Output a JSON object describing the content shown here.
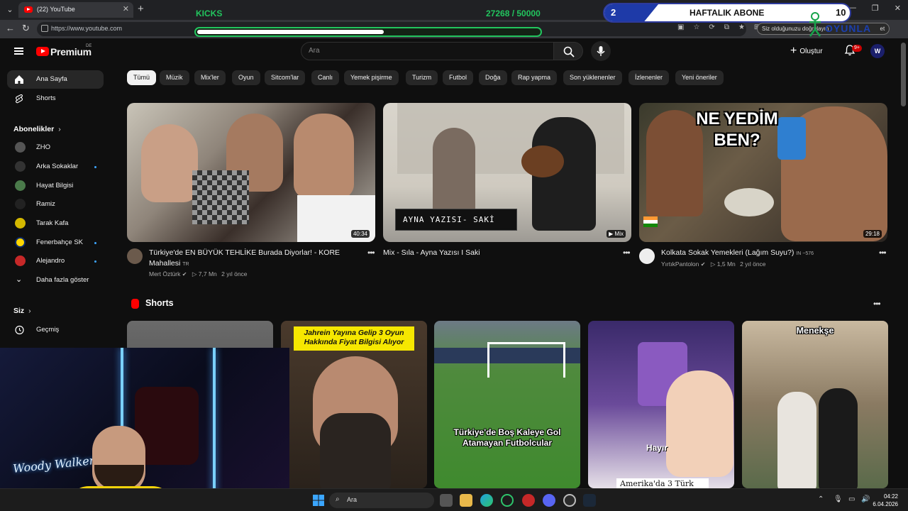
{
  "browser": {
    "tab_title": "(22) YouTube",
    "url": "https://www.youtube.com",
    "incognito_text": "Siz olduğunuzu doğrulayın",
    "incognito_suffix": "et"
  },
  "overlay": {
    "kicks_label": "KICKS",
    "kicks_count": "27268 / 50000",
    "kicks_progress": 0.545,
    "weekly_label": "HAFTALIK ABONE",
    "weekly_current": "2",
    "weekly_goal": "10",
    "brand_text": "OYUNLA"
  },
  "header": {
    "brand": "Premium",
    "region": "DE",
    "search_placeholder": "Ara",
    "create_label": "Oluştur",
    "notif_count": "9+",
    "avatar_letter": "W"
  },
  "sidebar": {
    "main": [
      {
        "label": "Ana Sayfa",
        "icon": "home-icon"
      },
      {
        "label": "Shorts",
        "icon": "shorts-icon"
      }
    ],
    "subs_heading": "Abonelikler",
    "subs": [
      {
        "label": "ZHO",
        "color": "#555",
        "dot": false
      },
      {
        "label": "Arka Sokaklar",
        "color": "#333",
        "dot": true
      },
      {
        "label": "Hayat Bilgisi",
        "color": "#4a7a4a",
        "dot": false
      },
      {
        "label": "Ramiz",
        "color": "#222",
        "dot": false
      },
      {
        "label": "Tarak Kafa",
        "color": "#d4b800",
        "dot": false
      },
      {
        "label": "Fenerbahçe SK",
        "color": "#ffd600",
        "dot": true
      },
      {
        "label": "Alejandro",
        "color": "#c62828",
        "dot": true
      }
    ],
    "show_more": "Daha fazla göster",
    "you_heading": "Siz",
    "history": "Geçmiş"
  },
  "chips": [
    "Tümü",
    "Müzik",
    "Mix'ler",
    "Oyun",
    "Sitcom'lar",
    "Canlı",
    "Yemek pişirme",
    "Turizm",
    "Futbol",
    "Doğa",
    "Rap yapma",
    "Son yüklenenler",
    "İzlenenler",
    "Yeni öneriler"
  ],
  "videos": [
    {
      "title": "Türkiye'de EN BÜYÜK TEHLİKE Burada Diyorlar! - KORE Mahallesi",
      "suffix": "TR",
      "channel": "Mert Öztürk",
      "views": "7,7 Mn",
      "age": "2 yıl önce",
      "duration": "40:34"
    },
    {
      "title": "Mix - Sıla - Ayna Yazısı I Saki",
      "overlay_text": "AYNA YAZISI- SAKİ",
      "badge": "Mix"
    },
    {
      "title": "Kolkata Sokak Yemekleri (Lağım Suyu?)",
      "suffix": "IN ~576",
      "channel": "YırtıkPantolon",
      "views": "1,5 Mn",
      "age": "2 yıl önce",
      "duration": "29:18",
      "overlay_text": "NE YEDİM BEN?"
    }
  ],
  "shorts": {
    "heading": "Shorts",
    "items": [
      {
        "caption": ""
      },
      {
        "caption": "Jahrein Yayına Gelip 3 Oyun Hakkında Fiyat Bilgisi Alıyor"
      },
      {
        "caption": "Türkiye'de Boş Kaleye Gol Atamayan Futbolcular"
      },
      {
        "caption": "Hayır",
        "caption2": "Amerika'da 3 Türk"
      },
      {
        "caption": "Menekşe"
      }
    ]
  },
  "taskbar": {
    "search_label": "Ara",
    "time": "04:22",
    "date": "6.04.2026"
  },
  "webcam": {
    "neon_text": "Woody Walker"
  }
}
